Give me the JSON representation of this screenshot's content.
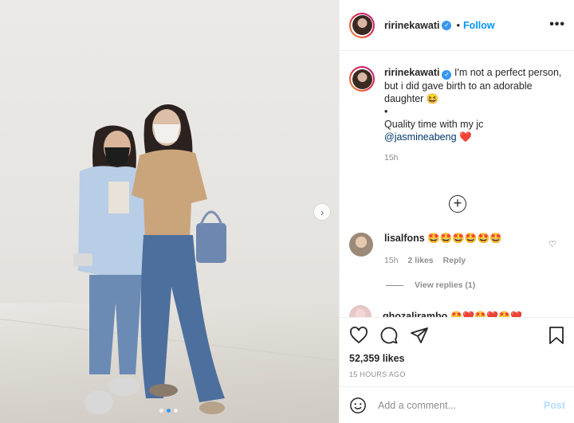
{
  "post": {
    "username": "ririnekawati",
    "verified_icon": "verified-badge-icon",
    "separator": "•",
    "follow_label": "Follow",
    "more_icon": "more-options-icon",
    "more_label": "•••"
  },
  "caption": {
    "username": "ririnekawati",
    "line1": "I'm not a perfect person,",
    "line2": "but i did gave birth to an adorable daughter 😆",
    "line3": "•",
    "line4": "Quality time with my jc",
    "mention": "@jasmineabeng",
    "mention_emoji": "❤️",
    "time": "15h"
  },
  "load_more_label": "+",
  "comments": [
    {
      "username": "lisalfons",
      "text": "🤩🤩🤩🤩🤩🤩",
      "time": "15h",
      "likes": "2 likes",
      "reply_label": "Reply",
      "view_replies": "View replies (1)"
    },
    {
      "username": "ghozalirambo",
      "text": "🤩❤️🤩❤️🤩❤️"
    }
  ],
  "likes": "52,359 likes",
  "posted_ago": "15 HOURS AGO",
  "add_comment_placeholder": "Add a comment...",
  "post_label": "Post",
  "carousel": {
    "current": 2,
    "total": 3,
    "next_icon": "chevron-right-icon",
    "next_label": "›"
  },
  "colors": {
    "accent": "#0095f6",
    "verified": "#3897f0",
    "mention": "#00376b",
    "muted": "#8e8e8e"
  }
}
